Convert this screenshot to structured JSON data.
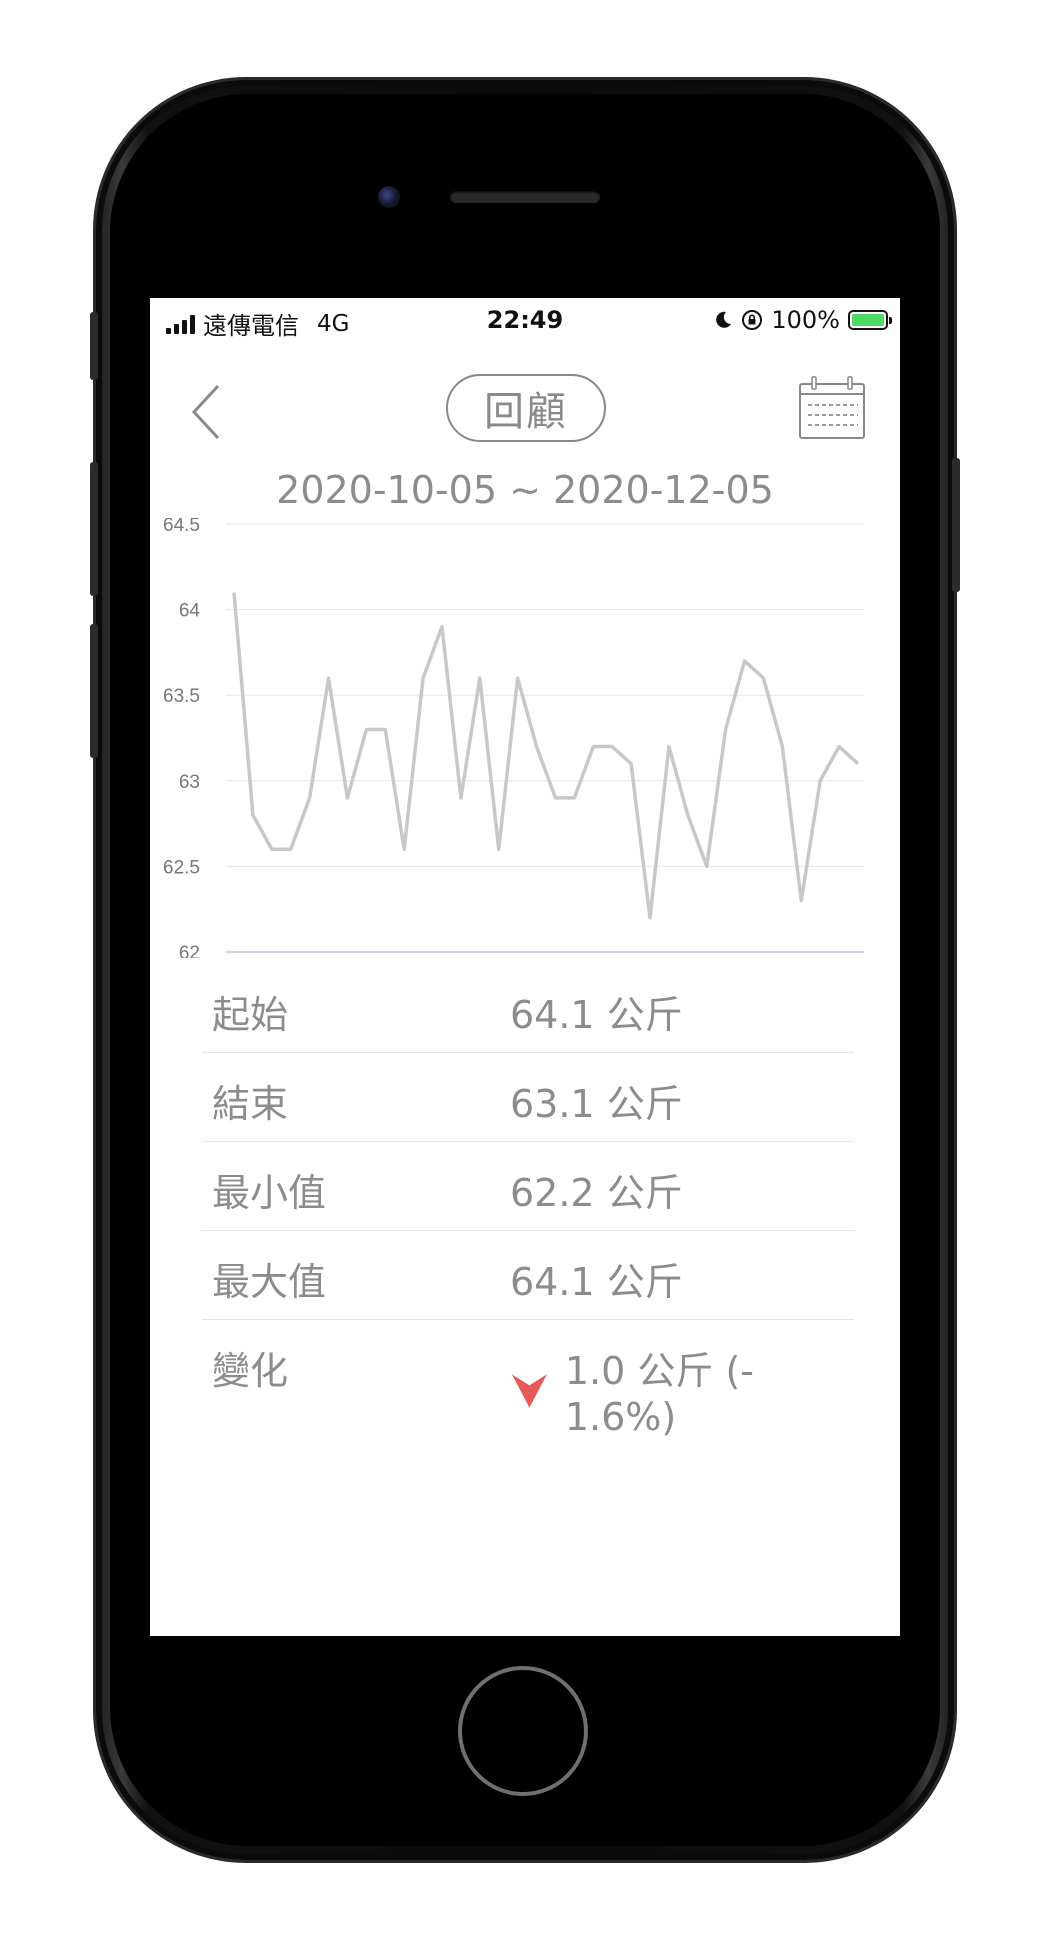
{
  "status_bar": {
    "carrier": "遠傳電信",
    "network": "4G",
    "time": "22:49",
    "battery": "100%"
  },
  "header": {
    "title": "回顧",
    "back_icon": "chevron-left-icon",
    "calendar_icon": "calendar-icon"
  },
  "date_range": "2020-10-05 ~ 2020-12-05",
  "chart_data": {
    "type": "line",
    "title": "",
    "xlabel": "",
    "ylabel": "",
    "ylim": [
      62,
      64.5
    ],
    "yticks": [
      "64.5",
      "64",
      "63.5",
      "63",
      "62.5",
      "62"
    ],
    "grid": true,
    "line_color": "#c8c8c8",
    "values": [
      64.1,
      62.8,
      62.6,
      62.6,
      62.9,
      63.6,
      62.9,
      63.3,
      63.3,
      62.6,
      63.6,
      63.9,
      62.9,
      63.6,
      62.6,
      63.6,
      63.2,
      62.9,
      62.9,
      63.2,
      63.2,
      63.1,
      62.2,
      63.2,
      62.8,
      62.5,
      63.3,
      63.7,
      63.6,
      63.2,
      62.3,
      63.0,
      63.2,
      63.1
    ]
  },
  "stats": [
    {
      "label": "起始",
      "value": "64.1 公斤"
    },
    {
      "label": "結束",
      "value": "63.1 公斤"
    },
    {
      "label": "最小值",
      "value": "62.2 公斤"
    },
    {
      "label": "最大值",
      "value": "64.1 公斤"
    }
  ],
  "change": {
    "label": "變化",
    "value": "1.0 公斤 (- 1.6%)",
    "icon": "down-arrow-icon",
    "arrow_color": "#e85a5a"
  }
}
